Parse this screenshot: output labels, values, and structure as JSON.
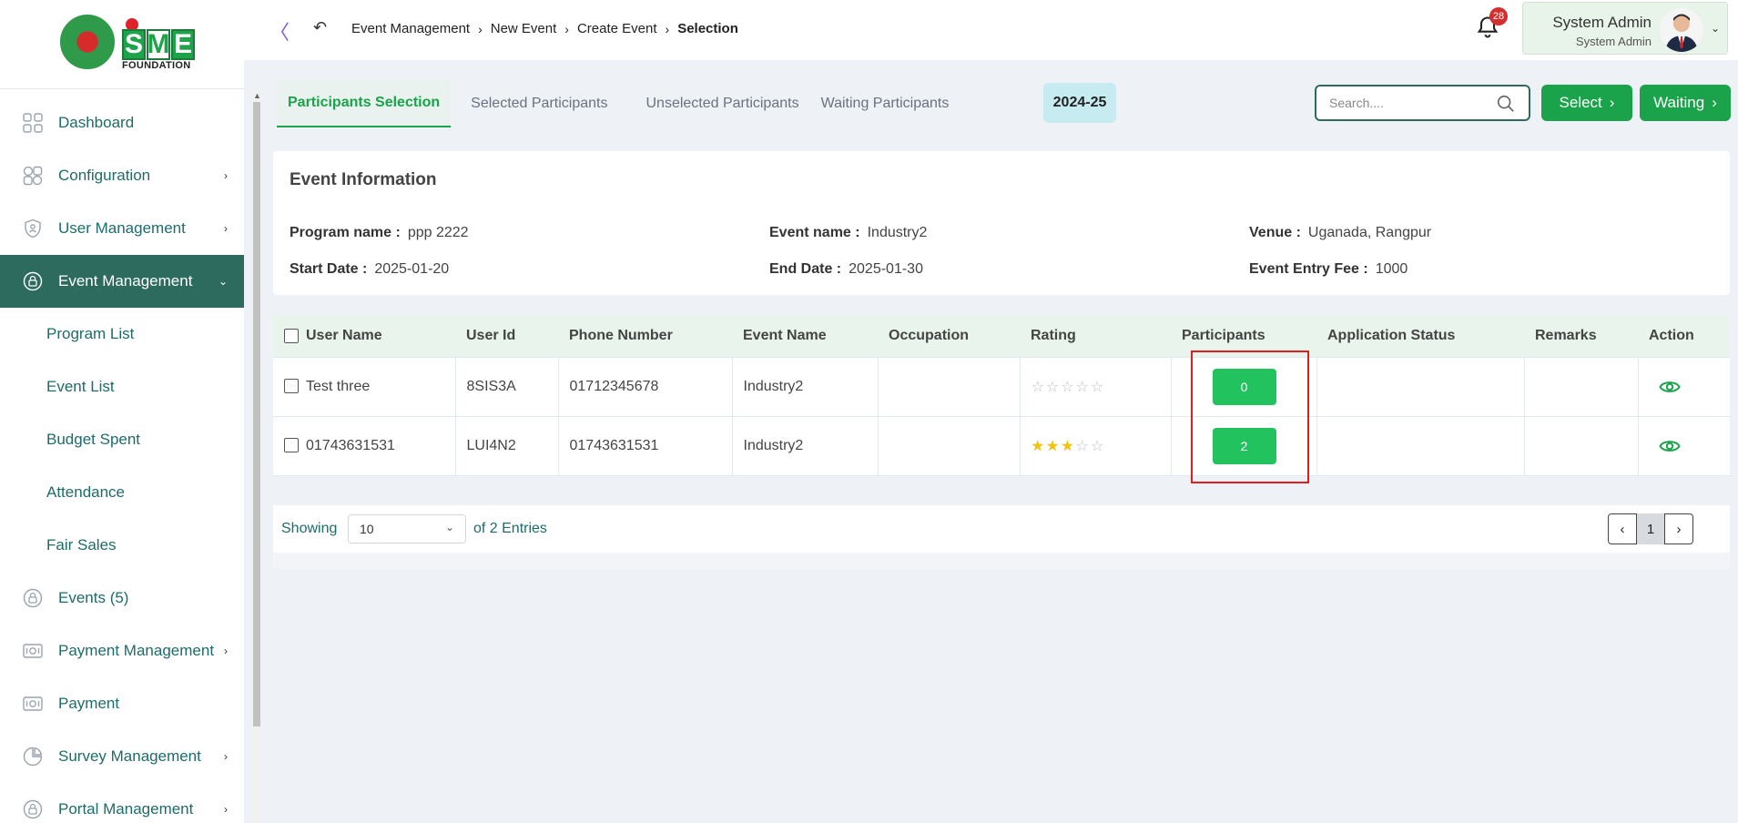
{
  "brand": {
    "logo_letters": [
      "S",
      "M",
      "E"
    ],
    "logo_text": "FOUNDATION"
  },
  "sidebar": {
    "items": [
      {
        "label": "Dashboard",
        "icon": "grid-icon",
        "chevron": ""
      },
      {
        "label": "Configuration",
        "icon": "config-icon",
        "chevron": "›"
      },
      {
        "label": "User Management",
        "icon": "shield-icon",
        "chevron": "›"
      },
      {
        "label": "Event Management",
        "icon": "lock-circle-icon",
        "chevron": "⌄",
        "active": true
      }
    ],
    "subitems": [
      "Program List",
      "Event List",
      "Budget Spent",
      "Attendance",
      "Fair Sales"
    ],
    "items_after": [
      {
        "label": "Events (5)",
        "icon": "lock-circle-icon",
        "chevron": ""
      },
      {
        "label": "Payment Management",
        "icon": "cash-icon",
        "chevron": "›"
      },
      {
        "label": "Payment",
        "icon": "cash-icon",
        "chevron": ""
      },
      {
        "label": "Survey Management",
        "icon": "pie-icon",
        "chevron": "›"
      },
      {
        "label": "Portal Management",
        "icon": "lock-circle-icon",
        "chevron": "›"
      }
    ]
  },
  "header": {
    "collapse_glyph": "〈",
    "back_glyph": "↶",
    "breadcrumb": [
      "Event Management",
      "New Event",
      "Create Event",
      "Selection"
    ],
    "breadcrumb_sep": "›",
    "notifications": "28",
    "user_name": "System Admin",
    "user_role": "System Admin",
    "caret": "⌄"
  },
  "tabs": [
    "Participants Selection",
    "Selected Participants",
    "Unselected Participants",
    "Waiting Participants"
  ],
  "year": "2024-25",
  "search": {
    "placeholder": "Search...."
  },
  "buttons": {
    "select": "Select",
    "waiting": "Waiting",
    "arrow": "›"
  },
  "event_info": {
    "title": "Event Information",
    "program_name_label": "Program name :",
    "program_name": "ppp 2222",
    "event_name_label": "Event name :",
    "event_name": "Industry2",
    "venue_label": "Venue :",
    "venue": "Uganada, Rangpur",
    "start_date_label": "Start Date :",
    "start_date": "2025-01-20",
    "end_date_label": "End Date :",
    "end_date": "2025-01-30",
    "fee_label": "Event Entry Fee :",
    "fee": "1000"
  },
  "table": {
    "columns": [
      "User Name",
      "User Id",
      "Phone Number",
      "Event Name",
      "Occupation",
      "Rating",
      "Participants",
      "Application Status",
      "Remarks",
      "Action"
    ],
    "rows": [
      {
        "user_name": "Test three",
        "user_id": "8SIS3A",
        "phone": "01712345678",
        "event": "Industry2",
        "occupation": "",
        "rating": 0,
        "participants": "0",
        "status": "",
        "remarks": ""
      },
      {
        "user_name": "01743631531",
        "user_id": "LUI4N2",
        "phone": "01743631531",
        "event": "Industry2",
        "occupation": "",
        "rating": 3,
        "participants": "2",
        "status": "",
        "remarks": ""
      }
    ],
    "rating_max": 5
  },
  "footer": {
    "showing": "Showing",
    "page_size": "10",
    "entries": "of 2 Entries",
    "page": "1",
    "prev": "‹",
    "next": "›",
    "select_caret": "⌄"
  },
  "colors": {
    "primary": "#1aa34a",
    "sidebar_active": "#2d6b5f",
    "highlight": "#e01e1e",
    "star": "#f2c40f"
  }
}
